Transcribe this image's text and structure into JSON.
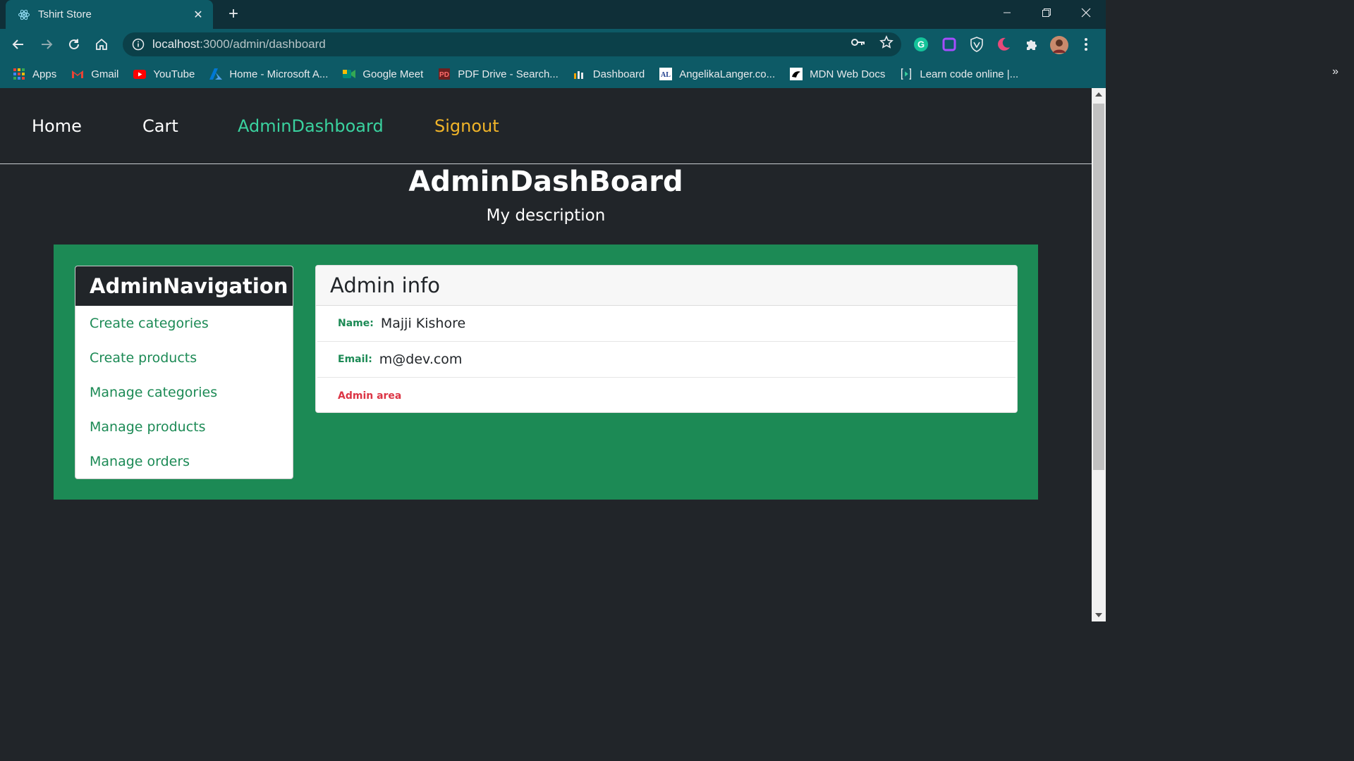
{
  "browser": {
    "tab_title": "Tshirt Store",
    "url_host": "localhost",
    "url_path": ":3000/admin/dashboard",
    "bookmarks": [
      {
        "label": "Apps",
        "icon": "apps-grid-icon",
        "color": "#e94235"
      },
      {
        "label": "Gmail",
        "icon": "gmail-icon",
        "color": "#ea4335"
      },
      {
        "label": "YouTube",
        "icon": "youtube-icon",
        "color": "#ff0000"
      },
      {
        "label": "Home - Microsoft A...",
        "icon": "azure-icon",
        "color": "#0078d4"
      },
      {
        "label": "Google Meet",
        "icon": "google-meet-icon",
        "color": "#00897b"
      },
      {
        "label": "PDF Drive - Search...",
        "icon": "pdf-drive-icon",
        "color": "#b3261e"
      },
      {
        "label": "Dashboard",
        "icon": "dashboard-icon",
        "color": "#f4a300"
      },
      {
        "label": "AngelikaLanger.co...",
        "icon": "angelika-langer-icon",
        "color": "#1b3a8a"
      },
      {
        "label": "MDN Web Docs",
        "icon": "mdn-icon",
        "color": "#000000"
      },
      {
        "label": "Learn code online |...",
        "icon": "code-brackets-icon",
        "color": "#3ad29f"
      }
    ],
    "bookmarks_more": "»"
  },
  "site_nav": {
    "home": "Home",
    "cart": "Cart",
    "admin_dashboard": "AdminDashboard",
    "signout": "Signout"
  },
  "jumbotron": {
    "title": "AdminDashBoard",
    "description": "My description"
  },
  "admin_navigation": {
    "header": "AdminNavigation",
    "items": [
      "Create categories",
      "Create products",
      "Manage categories",
      "Manage products",
      "Manage orders"
    ]
  },
  "admin_info": {
    "header": "Admin info",
    "name_label": "Name:",
    "name_value": "Majji Kishore",
    "email_label": "Email:",
    "email_value": "m@dev.com",
    "area_badge": "Admin area"
  },
  "colors": {
    "page_bg": "#212529",
    "green": "#1c8a55",
    "active_link": "#3ad29f",
    "signout": "#f0b429",
    "danger": "#dc3545",
    "chrome": "#0d5a66"
  }
}
